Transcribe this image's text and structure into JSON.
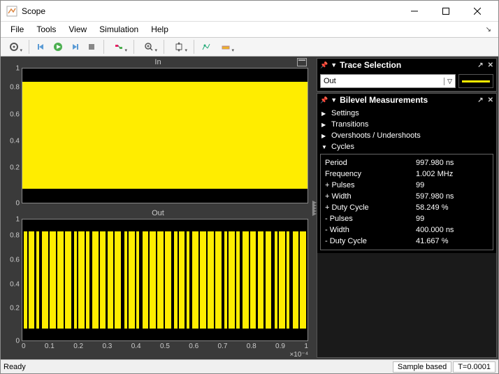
{
  "window": {
    "title": "Scope"
  },
  "menubar": {
    "file": "File",
    "tools": "Tools",
    "view": "View",
    "simulation": "Simulation",
    "help": "Help"
  },
  "plots": {
    "in": {
      "title": "In",
      "yticks": [
        "0",
        "0.2",
        "0.4",
        "0.6",
        "0.8",
        "1"
      ]
    },
    "out": {
      "title": "Out",
      "yticks": [
        "0",
        "0.2",
        "0.4",
        "0.6",
        "0.8",
        "1"
      ]
    },
    "xticks": [
      "0",
      "0.1",
      "0.2",
      "0.3",
      "0.4",
      "0.5",
      "0.6",
      "0.7",
      "0.8",
      "0.9",
      "1"
    ],
    "xexp": "×10⁻⁴"
  },
  "trace": {
    "panel_title": "Trace Selection",
    "selected": "Out"
  },
  "bilevel": {
    "panel_title": "Bilevel Measurements",
    "settings": "Settings",
    "transitions": "Transitions",
    "overshoots": "Overshoots / Undershoots",
    "cycles": "Cycles",
    "rows": {
      "period": {
        "k": "Period",
        "v": "997.980 ns"
      },
      "frequency": {
        "k": "Frequency",
        "v": "1.002 MHz"
      },
      "ppulses": {
        "k": "+ Pulses",
        "v": "99"
      },
      "pwidth": {
        "k": "+ Width",
        "v": "597.980 ns"
      },
      "pduty": {
        "k": "+ Duty Cycle",
        "v": "58.249 %"
      },
      "npulses": {
        "k": "- Pulses",
        "v": "99"
      },
      "nwidth": {
        "k": "- Width",
        "v": "400.000 ns"
      },
      "nduty": {
        "k": "- Duty Cycle",
        "v": "41.667 %"
      }
    }
  },
  "status": {
    "ready": "Ready",
    "mode": "Sample based",
    "time": "T=0.0001"
  },
  "chart_data": [
    {
      "type": "line",
      "name": "In",
      "title": "In",
      "xlabel": "",
      "ylabel": "",
      "xlim": [
        0,
        0.0001
      ],
      "ylim": [
        0,
        1
      ],
      "description": "Dense square wave toggling 0↔1 (~1 MHz), rendered solid yellow at this scale."
    },
    {
      "type": "line",
      "name": "Out",
      "title": "Out",
      "xlabel": "",
      "ylabel": "",
      "xlim": [
        0,
        0.0001
      ],
      "ylim": [
        0,
        1
      ],
      "description": "Square wave 0↔1, period≈997.98 ns, +duty≈58.25 %, −duty≈41.67 %, 99 pulses over 1e-4 s."
    }
  ]
}
